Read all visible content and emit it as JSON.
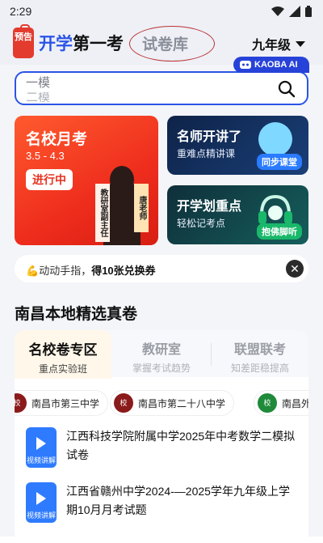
{
  "status": {
    "time": "2:29"
  },
  "header": {
    "promo_tag": "预告",
    "title_blue": "开学",
    "title_dark": "第一考",
    "tab2": "试卷库",
    "grade": "九年级"
  },
  "search": {
    "ai_badge": "KAOBA AI",
    "hint": "一模",
    "hint_next": "二模"
  },
  "cards": {
    "exam": {
      "title": "名校月考",
      "dates": "3.5 - 4.3",
      "status": "进行中",
      "sign1": "教研室副主任",
      "sign2": "唐老师"
    },
    "teacher": {
      "title": "名师开讲了",
      "subtitle": "重难点精讲课",
      "tag": "同步课堂"
    },
    "key": {
      "title": "开学划重点",
      "subtitle": "轻松记考点",
      "tag": "抱佛脚听"
    }
  },
  "tip": {
    "prefix": "动动手指，",
    "bold": "得10张兑换券",
    "close": "✕"
  },
  "section": {
    "title": "南昌本地精选真卷"
  },
  "tabs": [
    {
      "label": "名校卷专区",
      "sub": "重点实验班"
    },
    {
      "label": "教研室",
      "sub": "掌握考试趋势"
    },
    {
      "label": "联盟联考",
      "sub": "知差距稳提高"
    }
  ],
  "schools": [
    {
      "name": "南昌市第三中学"
    },
    {
      "name": "南昌市第二十八中学"
    },
    {
      "name": "南昌外"
    }
  ],
  "papers": [
    {
      "label": "视频讲解",
      "title": "江西科技学院附属中学2025年中考数学二模拟试卷"
    },
    {
      "label": "视频讲解",
      "title": "江西省赣州中学2024-—2025学年九年级上学期10月月考试题"
    }
  ]
}
